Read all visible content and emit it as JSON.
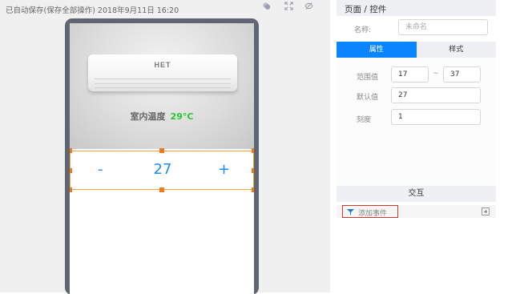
{
  "autosave_status": "已自动保存(保存全部操作) 2018年9月11日 16:20",
  "toolbar": {
    "icons": [
      "layers-icon",
      "fullscreen-icon",
      "hide-icon"
    ]
  },
  "canvas": {
    "ac_brand": "HET",
    "indoor_temp_label": "室内温度",
    "indoor_temp_value": "29°C",
    "temp_color": "#27c72c",
    "stepper": {
      "minus": "-",
      "value": "27",
      "plus": "+",
      "color": "#1a8cff",
      "selection_color": "#f5a23e"
    }
  },
  "panel": {
    "title": "页面 / 控件",
    "name_label": "名称:",
    "name_placeholder": "未命名",
    "tabs": [
      {
        "label": "属性",
        "active": true
      },
      {
        "label": "样式",
        "active": false
      }
    ],
    "accent_color": "#0a84ff",
    "range_label": "范围值",
    "range_min": "17",
    "range_separator": "~",
    "range_max": "37",
    "default_label": "默认值",
    "default_value": "27",
    "step_label": "刻度",
    "step_value": "1",
    "interaction_title": "交互",
    "add_event_label": "添加事件",
    "add_event_icon": "event-icon",
    "add_icon": "plus-box-icon"
  }
}
